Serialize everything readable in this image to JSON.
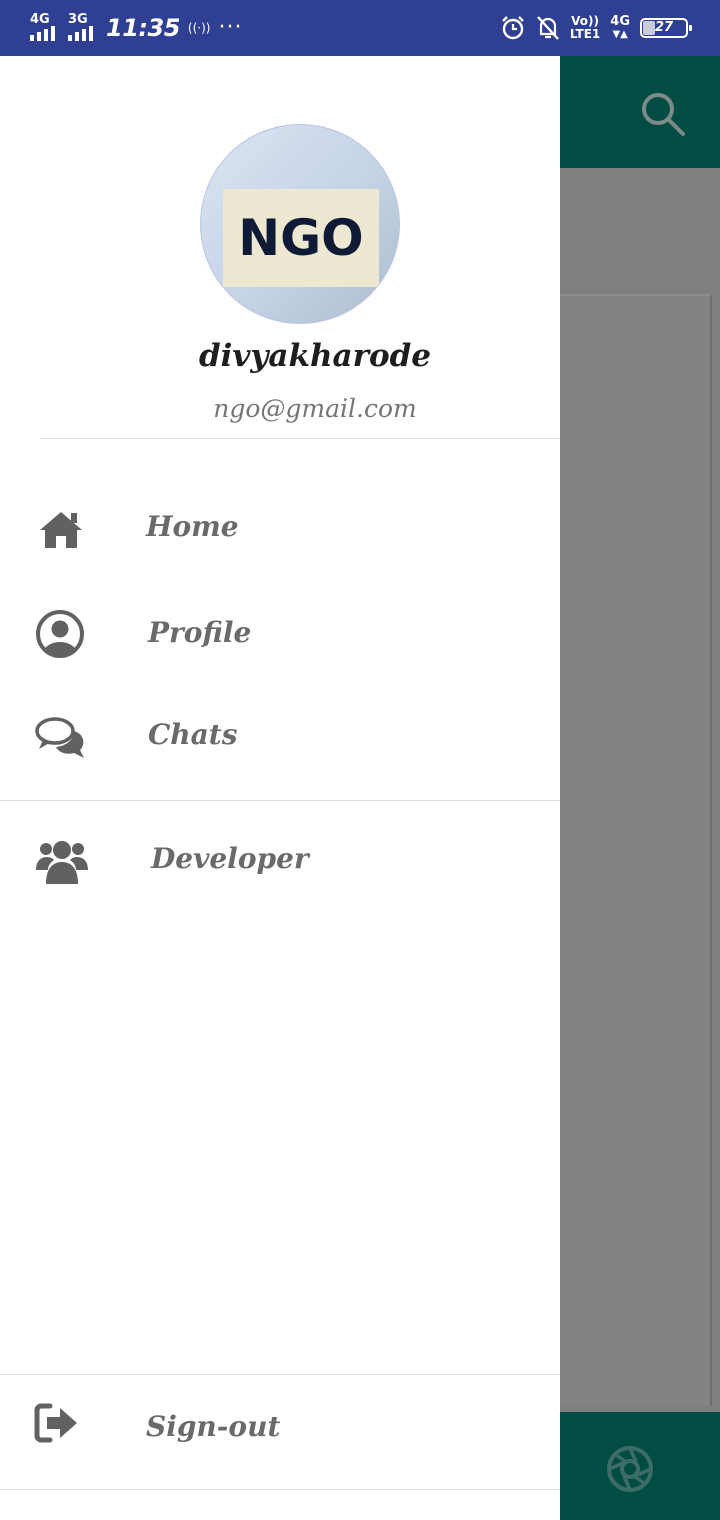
{
  "status_bar": {
    "sim1_type": "4G",
    "sim2_type": "3G",
    "time": "11:35",
    "volte_top": "Vo))",
    "volte_bottom": "LTE1",
    "network": "4G",
    "battery_level": "27",
    "battery_fraction": 0.27
  },
  "drawer": {
    "avatar_text": "NGO",
    "user_name": "divyakharode",
    "user_email": "ngo@gmail.com",
    "menu": [
      {
        "label": "Home",
        "icon": "home-icon"
      },
      {
        "label": "Profile",
        "icon": "account-circle-icon"
      },
      {
        "label": "Chats",
        "icon": "chat-bubbles-icon"
      },
      {
        "label": "Developer",
        "icon": "users-group-icon"
      }
    ],
    "signout": {
      "label": "Sign-out",
      "icon": "sign-out-icon"
    }
  },
  "background_app": {
    "appbar_icon": "search-icon",
    "bottombar_icon": "camera-aperture-icon",
    "accent_color": "#014d44"
  },
  "colors": {
    "status_bar": "#2f3f93",
    "scrim": "#7f7f7f",
    "menu_text": "#6a6a6a"
  }
}
